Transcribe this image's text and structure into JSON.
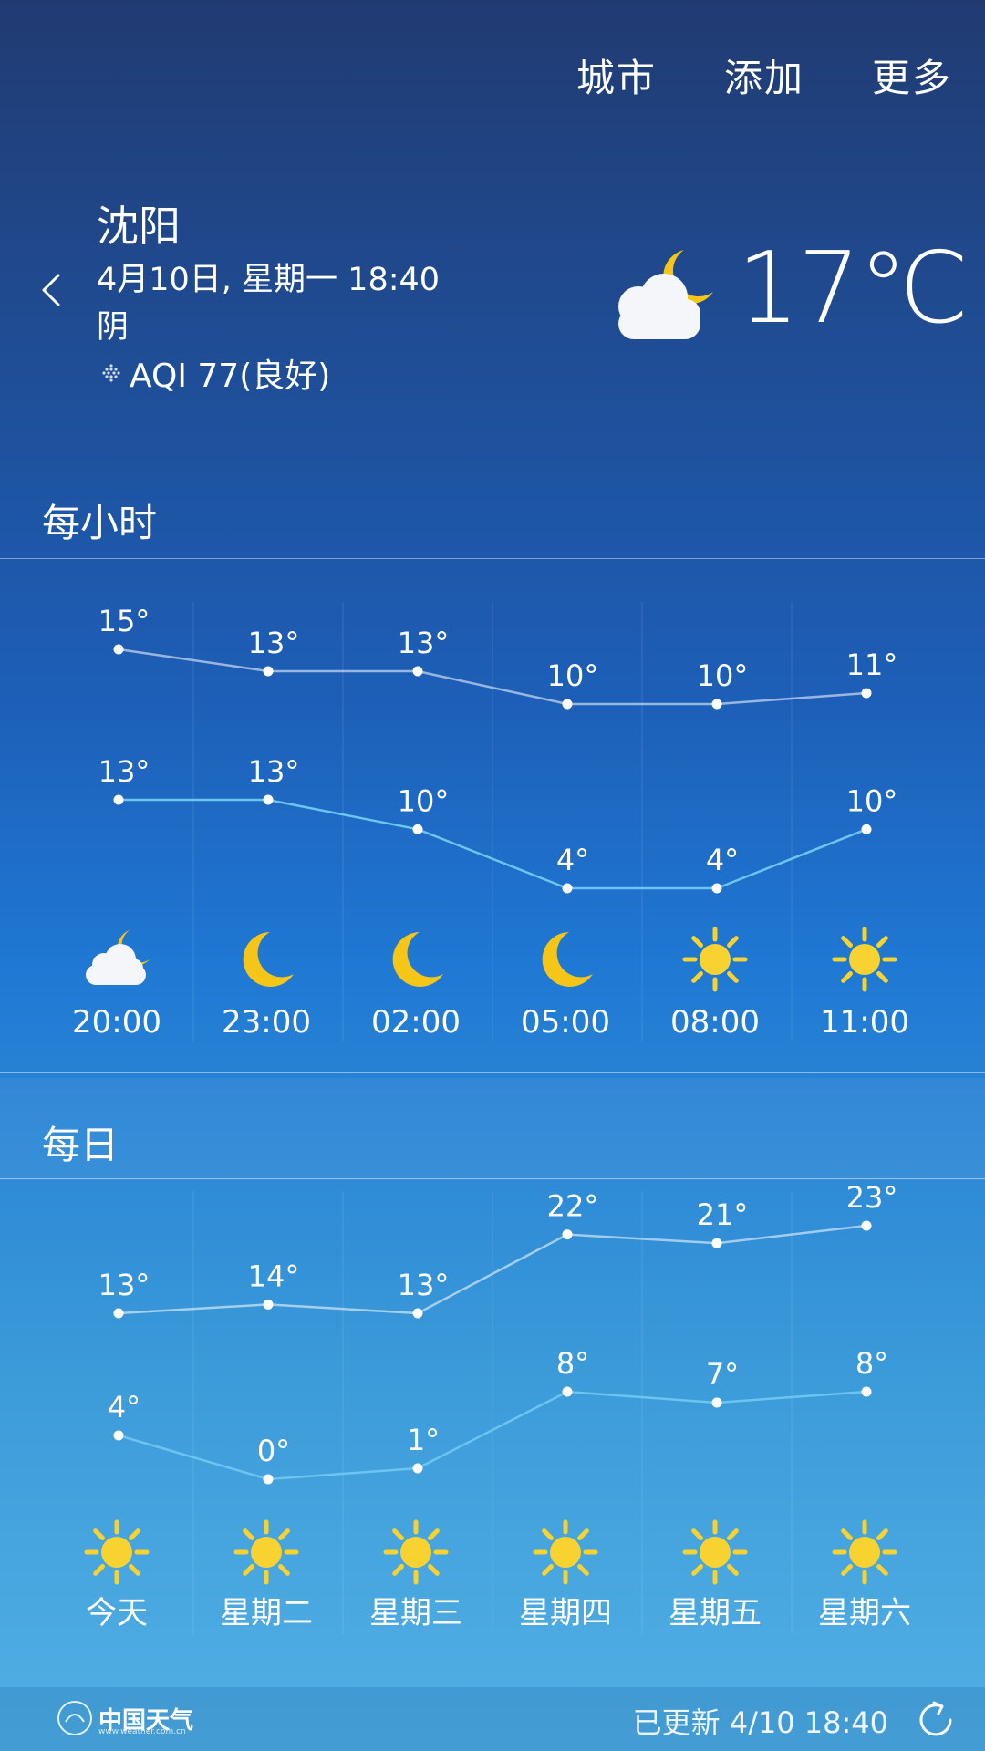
{
  "nav": {
    "city": "城市",
    "add": "添加",
    "more": "更多"
  },
  "location": {
    "city": "沈阳",
    "datetime": "4月10日, 星期一 18:40",
    "condition": "阴",
    "aqi": "AQI 77(良好)"
  },
  "current": {
    "temp": "17℃",
    "icon": "cloud-moon-icon"
  },
  "hourly": {
    "title": "每小时",
    "times": [
      "20:00",
      "23:00",
      "02:00",
      "05:00",
      "08:00",
      "11:00"
    ],
    "high": [
      15,
      13,
      13,
      10,
      10,
      11
    ],
    "low": [
      13,
      13,
      10,
      4,
      4,
      10
    ],
    "icons": [
      "cloud-moon-icon",
      "moon-icon",
      "moon-icon",
      "moon-icon",
      "sun-icon",
      "sun-icon"
    ]
  },
  "daily": {
    "title": "每日",
    "days": [
      "今天",
      "星期二",
      "星期三",
      "星期四",
      "星期五",
      "星期六"
    ],
    "high": [
      13,
      14,
      13,
      22,
      21,
      23
    ],
    "low": [
      4,
      0,
      1,
      8,
      7,
      8
    ],
    "icons": [
      "sun-icon",
      "sun-icon",
      "sun-icon",
      "sun-icon",
      "sun-icon",
      "sun-icon"
    ]
  },
  "footer": {
    "logo": "中国天气",
    "logo_sub": "www.weather.com.cn",
    "updated": "已更新 4/10  18:40"
  },
  "colors": {
    "sun": "#f7d230",
    "line_high": "rgba(255,255,255,0.55)",
    "line_low": "#6cc4f0",
    "moon": "#f5c518"
  }
}
